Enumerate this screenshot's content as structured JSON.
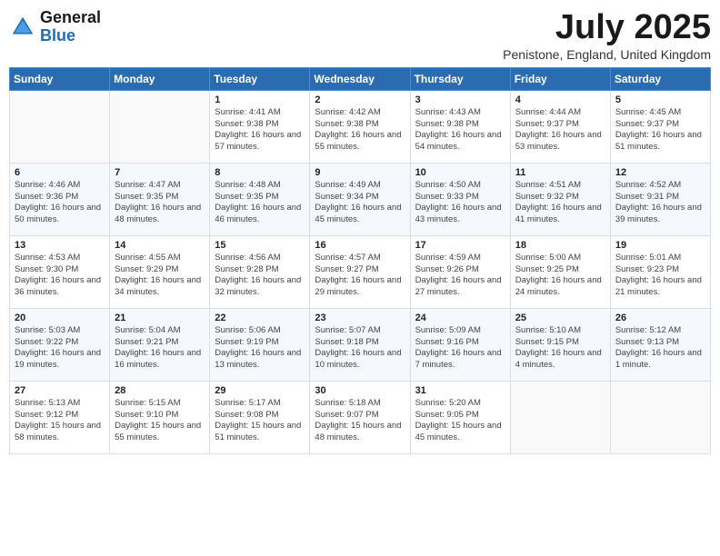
{
  "logo": {
    "general": "General",
    "blue": "Blue"
  },
  "title": {
    "month": "July 2025",
    "location": "Penistone, England, United Kingdom"
  },
  "weekdays": [
    "Sunday",
    "Monday",
    "Tuesday",
    "Wednesday",
    "Thursday",
    "Friday",
    "Saturday"
  ],
  "weeks": [
    [
      {
        "day": "",
        "sunrise": "",
        "sunset": "",
        "daylight": ""
      },
      {
        "day": "",
        "sunrise": "",
        "sunset": "",
        "daylight": ""
      },
      {
        "day": "1",
        "sunrise": "Sunrise: 4:41 AM",
        "sunset": "Sunset: 9:38 PM",
        "daylight": "Daylight: 16 hours and 57 minutes."
      },
      {
        "day": "2",
        "sunrise": "Sunrise: 4:42 AM",
        "sunset": "Sunset: 9:38 PM",
        "daylight": "Daylight: 16 hours and 55 minutes."
      },
      {
        "day": "3",
        "sunrise": "Sunrise: 4:43 AM",
        "sunset": "Sunset: 9:38 PM",
        "daylight": "Daylight: 16 hours and 54 minutes."
      },
      {
        "day": "4",
        "sunrise": "Sunrise: 4:44 AM",
        "sunset": "Sunset: 9:37 PM",
        "daylight": "Daylight: 16 hours and 53 minutes."
      },
      {
        "day": "5",
        "sunrise": "Sunrise: 4:45 AM",
        "sunset": "Sunset: 9:37 PM",
        "daylight": "Daylight: 16 hours and 51 minutes."
      }
    ],
    [
      {
        "day": "6",
        "sunrise": "Sunrise: 4:46 AM",
        "sunset": "Sunset: 9:36 PM",
        "daylight": "Daylight: 16 hours and 50 minutes."
      },
      {
        "day": "7",
        "sunrise": "Sunrise: 4:47 AM",
        "sunset": "Sunset: 9:35 PM",
        "daylight": "Daylight: 16 hours and 48 minutes."
      },
      {
        "day": "8",
        "sunrise": "Sunrise: 4:48 AM",
        "sunset": "Sunset: 9:35 PM",
        "daylight": "Daylight: 16 hours and 46 minutes."
      },
      {
        "day": "9",
        "sunrise": "Sunrise: 4:49 AM",
        "sunset": "Sunset: 9:34 PM",
        "daylight": "Daylight: 16 hours and 45 minutes."
      },
      {
        "day": "10",
        "sunrise": "Sunrise: 4:50 AM",
        "sunset": "Sunset: 9:33 PM",
        "daylight": "Daylight: 16 hours and 43 minutes."
      },
      {
        "day": "11",
        "sunrise": "Sunrise: 4:51 AM",
        "sunset": "Sunset: 9:32 PM",
        "daylight": "Daylight: 16 hours and 41 minutes."
      },
      {
        "day": "12",
        "sunrise": "Sunrise: 4:52 AM",
        "sunset": "Sunset: 9:31 PM",
        "daylight": "Daylight: 16 hours and 39 minutes."
      }
    ],
    [
      {
        "day": "13",
        "sunrise": "Sunrise: 4:53 AM",
        "sunset": "Sunset: 9:30 PM",
        "daylight": "Daylight: 16 hours and 36 minutes."
      },
      {
        "day": "14",
        "sunrise": "Sunrise: 4:55 AM",
        "sunset": "Sunset: 9:29 PM",
        "daylight": "Daylight: 16 hours and 34 minutes."
      },
      {
        "day": "15",
        "sunrise": "Sunrise: 4:56 AM",
        "sunset": "Sunset: 9:28 PM",
        "daylight": "Daylight: 16 hours and 32 minutes."
      },
      {
        "day": "16",
        "sunrise": "Sunrise: 4:57 AM",
        "sunset": "Sunset: 9:27 PM",
        "daylight": "Daylight: 16 hours and 29 minutes."
      },
      {
        "day": "17",
        "sunrise": "Sunrise: 4:59 AM",
        "sunset": "Sunset: 9:26 PM",
        "daylight": "Daylight: 16 hours and 27 minutes."
      },
      {
        "day": "18",
        "sunrise": "Sunrise: 5:00 AM",
        "sunset": "Sunset: 9:25 PM",
        "daylight": "Daylight: 16 hours and 24 minutes."
      },
      {
        "day": "19",
        "sunrise": "Sunrise: 5:01 AM",
        "sunset": "Sunset: 9:23 PM",
        "daylight": "Daylight: 16 hours and 21 minutes."
      }
    ],
    [
      {
        "day": "20",
        "sunrise": "Sunrise: 5:03 AM",
        "sunset": "Sunset: 9:22 PM",
        "daylight": "Daylight: 16 hours and 19 minutes."
      },
      {
        "day": "21",
        "sunrise": "Sunrise: 5:04 AM",
        "sunset": "Sunset: 9:21 PM",
        "daylight": "Daylight: 16 hours and 16 minutes."
      },
      {
        "day": "22",
        "sunrise": "Sunrise: 5:06 AM",
        "sunset": "Sunset: 9:19 PM",
        "daylight": "Daylight: 16 hours and 13 minutes."
      },
      {
        "day": "23",
        "sunrise": "Sunrise: 5:07 AM",
        "sunset": "Sunset: 9:18 PM",
        "daylight": "Daylight: 16 hours and 10 minutes."
      },
      {
        "day": "24",
        "sunrise": "Sunrise: 5:09 AM",
        "sunset": "Sunset: 9:16 PM",
        "daylight": "Daylight: 16 hours and 7 minutes."
      },
      {
        "day": "25",
        "sunrise": "Sunrise: 5:10 AM",
        "sunset": "Sunset: 9:15 PM",
        "daylight": "Daylight: 16 hours and 4 minutes."
      },
      {
        "day": "26",
        "sunrise": "Sunrise: 5:12 AM",
        "sunset": "Sunset: 9:13 PM",
        "daylight": "Daylight: 16 hours and 1 minute."
      }
    ],
    [
      {
        "day": "27",
        "sunrise": "Sunrise: 5:13 AM",
        "sunset": "Sunset: 9:12 PM",
        "daylight": "Daylight: 15 hours and 58 minutes."
      },
      {
        "day": "28",
        "sunrise": "Sunrise: 5:15 AM",
        "sunset": "Sunset: 9:10 PM",
        "daylight": "Daylight: 15 hours and 55 minutes."
      },
      {
        "day": "29",
        "sunrise": "Sunrise: 5:17 AM",
        "sunset": "Sunset: 9:08 PM",
        "daylight": "Daylight: 15 hours and 51 minutes."
      },
      {
        "day": "30",
        "sunrise": "Sunrise: 5:18 AM",
        "sunset": "Sunset: 9:07 PM",
        "daylight": "Daylight: 15 hours and 48 minutes."
      },
      {
        "day": "31",
        "sunrise": "Sunrise: 5:20 AM",
        "sunset": "Sunset: 9:05 PM",
        "daylight": "Daylight: 15 hours and 45 minutes."
      },
      {
        "day": "",
        "sunrise": "",
        "sunset": "",
        "daylight": ""
      },
      {
        "day": "",
        "sunrise": "",
        "sunset": "",
        "daylight": ""
      }
    ]
  ]
}
